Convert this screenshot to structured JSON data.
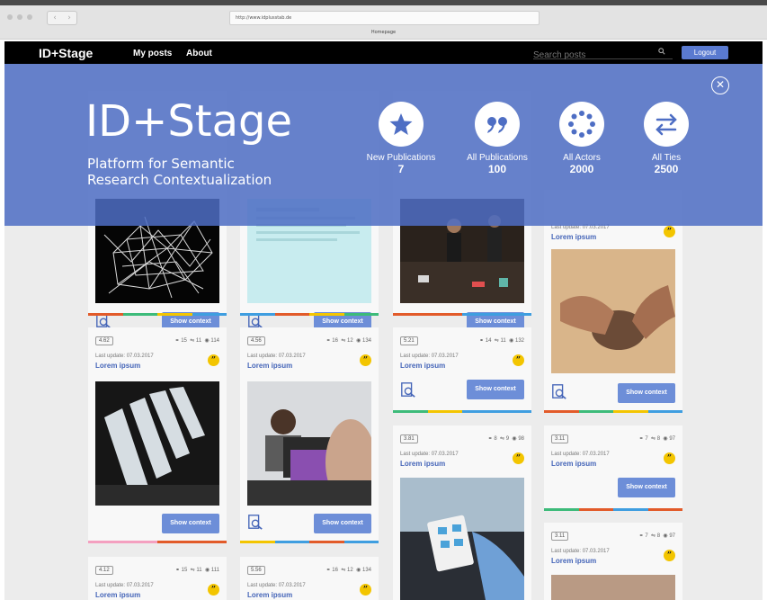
{
  "browser": {
    "url": "http://www.idplusstab.de",
    "tab_title": "Homepage"
  },
  "nav": {
    "brand": "ID+Stage",
    "my_posts": "My posts",
    "about": "About",
    "search_placeholder": "Search posts",
    "logout": "Logout"
  },
  "hero": {
    "title": "ID+Stage",
    "subtitle_line1": "Platform for Semantic",
    "subtitle_line2": "Research Contextualization",
    "stats": [
      {
        "label": "New Publications",
        "value": "7",
        "icon": "star-icon"
      },
      {
        "label": "All Publications",
        "value": "100",
        "icon": "quote-icon"
      },
      {
        "label": "All Actors",
        "value": "2000",
        "icon": "dots-circle-icon"
      },
      {
        "label": "All Ties",
        "value": "2500",
        "icon": "arrows-exchange-icon"
      }
    ]
  },
  "cards": {
    "show_context": "Show context",
    "quote_glyph": "”",
    "row2": [
      {
        "rating": "4.62",
        "links": "15",
        "ties": "11",
        "views": "114",
        "updated": "Last update: 07.03.2017",
        "title": "Lorem ipsum"
      },
      {
        "rating": "4.56",
        "links": "16",
        "ties": "12",
        "views": "134",
        "updated": "Last update: 07.03.2017",
        "title": "Lorem ipsum"
      },
      {
        "rating": "5.21",
        "links": "14",
        "ties": "11",
        "views": "132",
        "updated": "Last update: 07.03.2017",
        "title": "Lorem ipsum"
      },
      {
        "rating": "3.81",
        "links": "8",
        "ties": "9",
        "views": "98",
        "updated": "Last update: 07.03.2017",
        "title": "Lorem ipsum"
      },
      {
        "rating": "3.11",
        "links": "7",
        "ties": "8",
        "views": "97",
        "updated": "Last update: 07.03.2017",
        "title": "Lorem ipsum"
      },
      {
        "rating": "3.11",
        "links": "7",
        "ties": "8",
        "views": "97",
        "updated": "Last update: 07.03.2017",
        "title": "Lorem ipsum"
      }
    ],
    "row3": [
      {
        "rating": "4.12",
        "links": "15",
        "ties": "11",
        "views": "111",
        "updated": "Last update: 07.03.2017",
        "title": "Lorem ipsum"
      },
      {
        "rating": "5.56",
        "links": "16",
        "ties": "12",
        "views": "134",
        "updated": "Last update: 07.03.2017",
        "title": "Lorem ipsum"
      }
    ],
    "top_card": {
      "updated": "Last update: 07.03.2017",
      "title": "Lorem ipsum"
    }
  },
  "colors": {
    "accent": "#6d8ed8",
    "hero": "#4e6ec4",
    "quote_badge": "#f3c500",
    "link": "#4565b8"
  }
}
